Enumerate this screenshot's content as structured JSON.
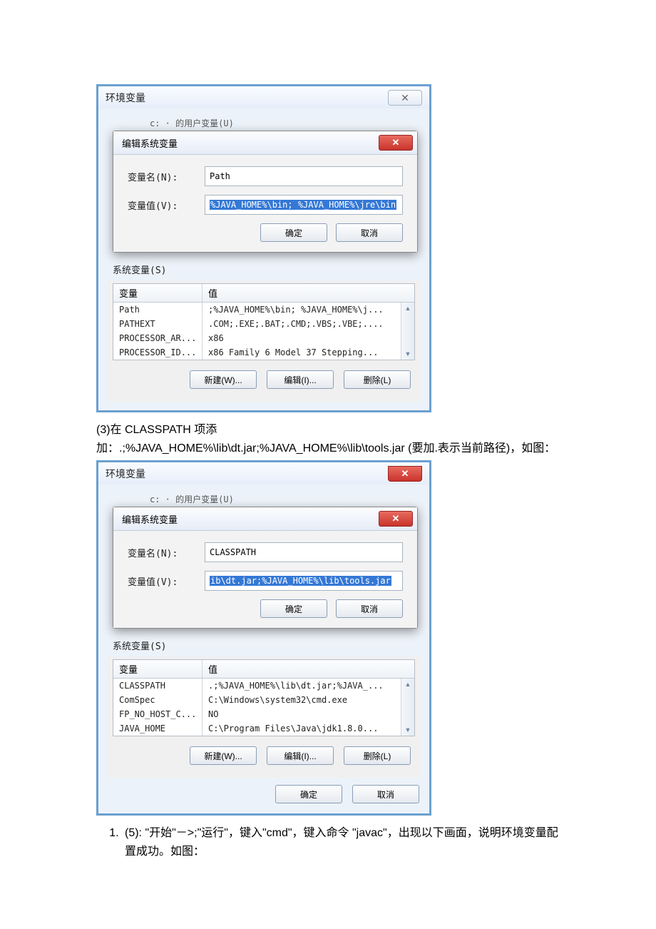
{
  "screenshot1": {
    "parent_title": "环境变量",
    "blur_row": "c:   · 的用户变量(U)",
    "dialog_title": "编辑系统变量",
    "name_label": "变量名(N):",
    "name_value": "Path",
    "value_label": "变量值(V):",
    "value_value": "%JAVA_HOME%\\bin; %JAVA_HOME%\\jre\\bin",
    "ok": "确定",
    "cancel": "取消",
    "group_label": "系统变量(S)",
    "col_var": "变量",
    "col_val": "值",
    "rows": [
      {
        "k": "Path",
        "v": ";%JAVA_HOME%\\bin; %JAVA_HOME%\\j..."
      },
      {
        "k": "PATHEXT",
        "v": ".COM;.EXE;.BAT;.CMD;.VBS;.VBE;...."
      },
      {
        "k": "PROCESSOR_AR...",
        "v": "x86"
      },
      {
        "k": "PROCESSOR_ID...",
        "v": "x86 Family 6 Model 37 Stepping..."
      }
    ],
    "btn_new": "新建(W)...",
    "btn_edit": "编辑(I)...",
    "btn_del": "删除(L)"
  },
  "text1": {
    "p1a": "(3)在 CLASSPATH 项添",
    "p1b": "加：.;%JAVA_HOME%\\lib\\dt.jar;%JAVA_HOME%\\lib\\tools.jar (要加.表示当前路径)，如图："
  },
  "screenshot2": {
    "parent_title": "环境变量",
    "blur_row": "c:   · 的用户变量(U)",
    "dialog_title": "编辑系统变量",
    "name_label": "变量名(N):",
    "name_value": "CLASSPATH",
    "value_label": "变量值(V):",
    "value_value": "ib\\dt.jar;%JAVA_HOME%\\lib\\tools.jar",
    "ok": "确定",
    "cancel": "取消",
    "group_label": "系统变量(S)",
    "col_var": "变量",
    "col_val": "值",
    "rows": [
      {
        "k": "CLASSPATH",
        "v": ".;%JAVA_HOME%\\lib\\dt.jar;%JAVA_..."
      },
      {
        "k": "ComSpec",
        "v": "C:\\Windows\\system32\\cmd.exe"
      },
      {
        "k": "FP_NO_HOST_C...",
        "v": "NO"
      },
      {
        "k": "JAVA_HOME",
        "v": "C:\\Program Files\\Java\\jdk1.8.0..."
      }
    ],
    "btn_new": "新建(W)...",
    "btn_edit": "编辑(I)...",
    "btn_del": "删除(L)",
    "footer_ok": "确定",
    "footer_cancel": "取消"
  },
  "list_item": "(5): \"开始\"－>;\"运行\"，键入\"cmd\"，键入命令 \"javac\"，出现以下画面，说明环境变量配置成功。如图："
}
